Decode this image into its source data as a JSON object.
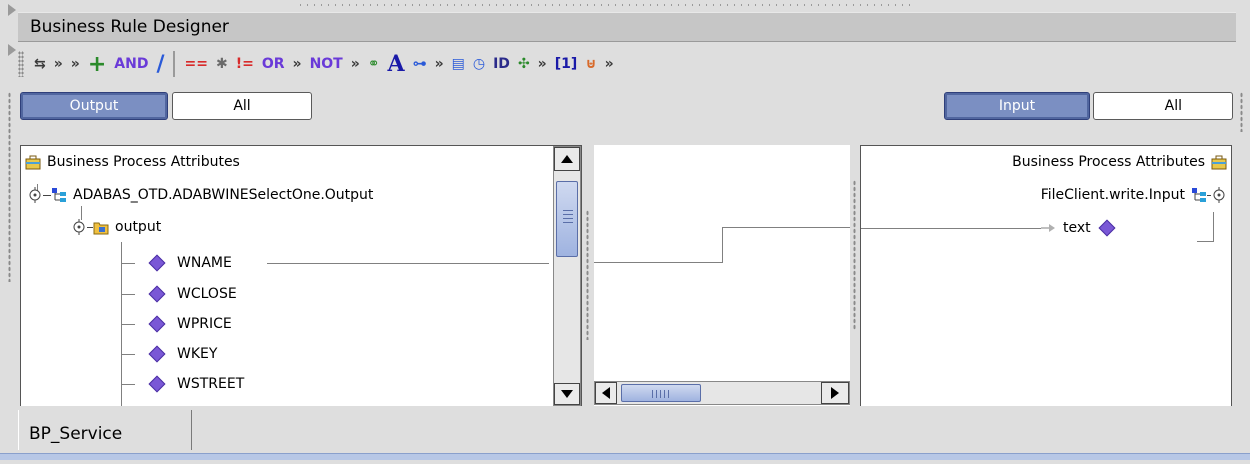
{
  "window": {
    "title": "Business Rule Designer"
  },
  "toolbar": {
    "items": [
      {
        "name": "rule-move-icon",
        "glyph": "⇆"
      },
      {
        "name": "more-chevron-1",
        "glyph": "»"
      },
      {
        "name": "more-chevron-2",
        "glyph": "»"
      },
      {
        "name": "add-icon",
        "glyph": "+"
      },
      {
        "name": "and-operator",
        "glyph": "AND"
      },
      {
        "name": "divide-icon",
        "glyph": "/"
      },
      {
        "name": "equals-operator",
        "glyph": "=="
      },
      {
        "name": "multiply-icon",
        "glyph": "✱"
      },
      {
        "name": "not-equals-operator",
        "glyph": "!="
      },
      {
        "name": "or-operator",
        "glyph": "OR"
      },
      {
        "name": "more-chevron-3",
        "glyph": "»"
      },
      {
        "name": "not-operator",
        "glyph": "NOT"
      },
      {
        "name": "more-chevron-4",
        "glyph": "»"
      },
      {
        "name": "concat-icon",
        "glyph": "⚭"
      },
      {
        "name": "string-literal-icon",
        "glyph": "A"
      },
      {
        "name": "link-icon",
        "glyph": "⊶"
      },
      {
        "name": "more-chevron-5",
        "glyph": "»"
      },
      {
        "name": "document-icon",
        "glyph": "▤"
      },
      {
        "name": "clock-icon",
        "glyph": "◷"
      },
      {
        "name": "id-icon",
        "glyph": "ID"
      },
      {
        "name": "split-icon",
        "glyph": "✣"
      },
      {
        "name": "more-chevron-6",
        "glyph": "»"
      },
      {
        "name": "array-index-icon",
        "glyph": "[1]"
      },
      {
        "name": "merge-icon",
        "glyph": "⊎"
      },
      {
        "name": "more-chevron-7",
        "glyph": "»"
      }
    ]
  },
  "left_filter": {
    "active": "Output",
    "inactive": "All"
  },
  "right_filter": {
    "active": "Input",
    "inactive": "All"
  },
  "left_tree": {
    "root": "Business Process Attributes",
    "otd": "ADABAS_OTD.ADABWINESelectOne.Output",
    "folder": "output",
    "fields": [
      "WNAME",
      "WCLOSE",
      "WPRICE",
      "WKEY",
      "WSTREET"
    ]
  },
  "right_tree": {
    "root": "Business Process Attributes",
    "otd": "FileClient.write.Input",
    "field": "text"
  },
  "colors": {
    "toggle_on": "#7b8fc2",
    "field_diamond": "#7a58d6",
    "scroll_thumb": "#9fb3e0"
  },
  "bottom_tab": {
    "label": "BP_Service"
  }
}
